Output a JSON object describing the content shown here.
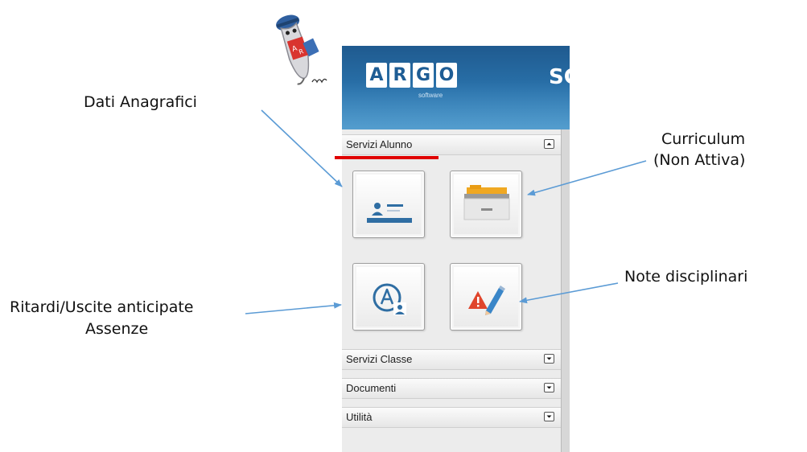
{
  "annotations": {
    "dati_anagrafici": "Dati Anagrafici",
    "curriculum_line1": "Curriculum",
    "curriculum_line2": "(Non Attiva)",
    "note_disciplinari": "Note disciplinari",
    "ritardi_line1": "Ritardi/Uscite anticipate",
    "ritardi_line2": "Assenze"
  },
  "logo": {
    "letters": [
      "A",
      "R",
      "G",
      "O"
    ],
    "subtitle": "software",
    "banner_cut_text": "SC"
  },
  "menu": {
    "servizi_alunno": "Servizi Alunno",
    "servizi_classe": "Servizi Classe",
    "documenti": "Documenti",
    "utilita": "Utilità"
  },
  "tiles": [
    {
      "name": "dati-anagrafici",
      "icon": "id-card-icon"
    },
    {
      "name": "curriculum",
      "icon": "folder-cabinet-icon"
    },
    {
      "name": "assenze",
      "icon": "absence-a-icon"
    },
    {
      "name": "note-disciplinari",
      "icon": "warning-pencil-icon"
    }
  ],
  "colors": {
    "annotation_arrow": "#5b9bd5",
    "underline": "#e00000",
    "banner": "#2a73ac",
    "icon_blue": "#2f6ea3",
    "warning_red": "#e0452c"
  }
}
